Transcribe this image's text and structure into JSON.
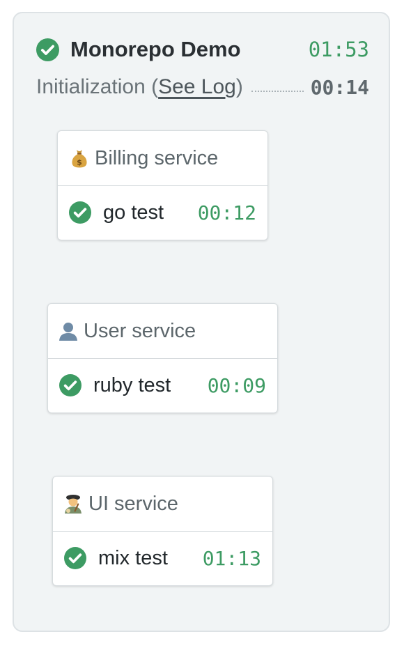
{
  "pipeline": {
    "title": "Monorepo Demo",
    "duration": "01:53",
    "status": "passed",
    "initialization": {
      "label_prefix": "Initialization (",
      "link_label": "See Log",
      "label_suffix": ")",
      "duration": "00:14"
    }
  },
  "blocks": [
    {
      "emoji": "money-bag-icon",
      "name": "Billing service",
      "job": {
        "name": "go test",
        "duration": "00:12",
        "status": "passed"
      }
    },
    {
      "emoji": "user-silhouette-icon",
      "name": "User service",
      "job": {
        "name": "ruby test",
        "duration": "00:09",
        "status": "passed"
      }
    },
    {
      "emoji": "artist-icon",
      "name": "UI service",
      "job": {
        "name": "mix test",
        "duration": "01:13",
        "status": "passed"
      }
    }
  ],
  "colors": {
    "success": "#3d9b63",
    "panel_bg": "#f1f4f5",
    "panel_border": "#dde2e5"
  }
}
